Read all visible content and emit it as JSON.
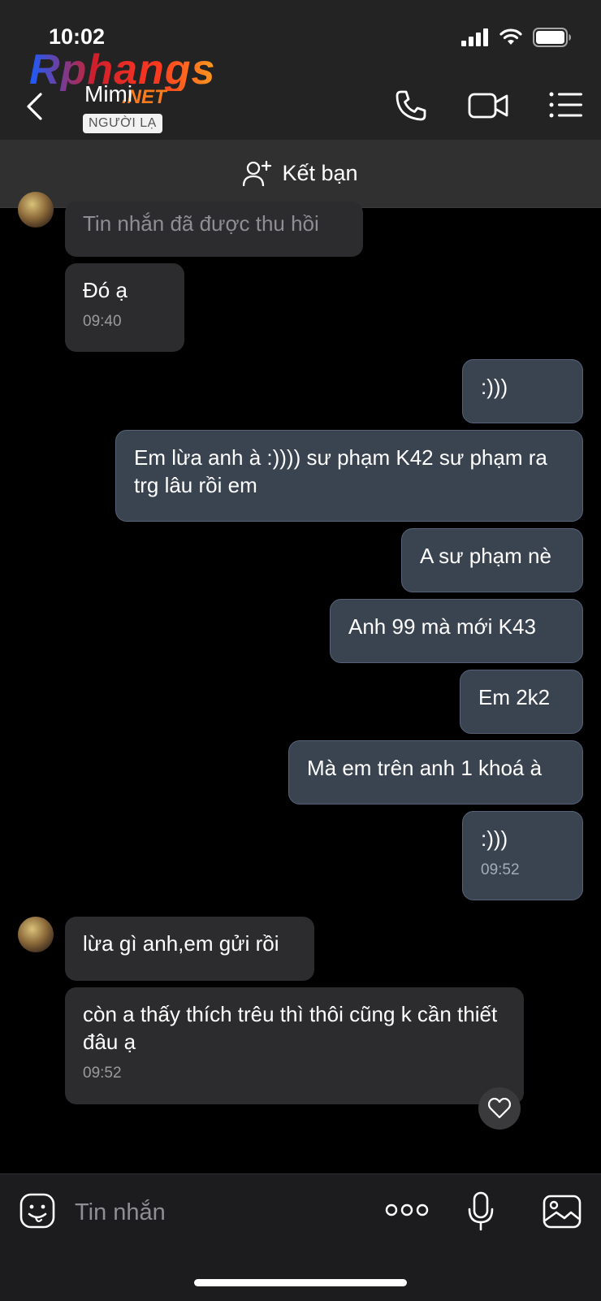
{
  "status_bar": {
    "time": "10:02"
  },
  "watermark": {
    "text": "Rphangs",
    "suffix": ".NET"
  },
  "header": {
    "contact_name": "Mimi",
    "badge": "NGƯỜI LẠ"
  },
  "add_friend": {
    "label": "Kết bạn"
  },
  "messages": {
    "m1": {
      "text": "Tin nhắn đã được thu hồi"
    },
    "m2": {
      "text": "Đó ạ",
      "time": "09:40"
    },
    "m3": {
      "text": ":)))"
    },
    "m4": {
      "text": "Em lừa anh à :)))) sư phạm K42 sư phạm ra trg lâu rồi em"
    },
    "m5": {
      "text": "A sư phạm nè"
    },
    "m6": {
      "text": "Anh 99 mà mới K43"
    },
    "m7": {
      "text": "Em 2k2"
    },
    "m8": {
      "text": "Mà em trên anh 1 khoá à"
    },
    "m9": {
      "text": ":)))",
      "time": "09:52"
    },
    "m10": {
      "text": "lừa gì anh,em gửi rồi"
    },
    "m11": {
      "text": "còn a thấy thích trêu thì thôi cũng k cần thiết đâu ạ",
      "time": "09:52"
    }
  },
  "input": {
    "placeholder": "Tin nhắn"
  },
  "colors": {
    "header_bg": "#232323",
    "add_friend_bg": "#303030",
    "incoming_bubble": "#2c2c2e",
    "outgoing_bubble": "#3a4350",
    "background": "#000000"
  }
}
